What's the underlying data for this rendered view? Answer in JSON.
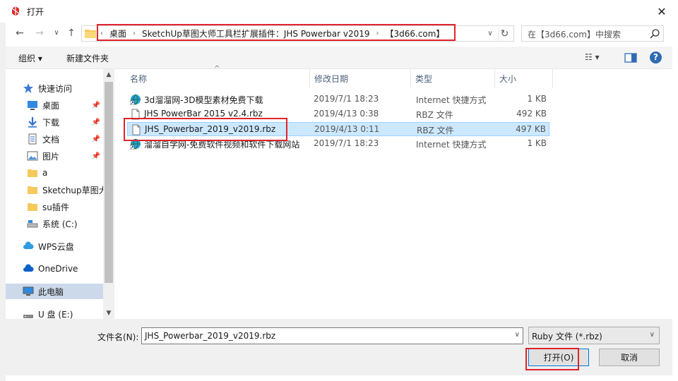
{
  "window": {
    "title": "打开",
    "close_glyph": "✕"
  },
  "nav": {
    "back": "←",
    "forward": "→",
    "dropdown": "∨",
    "up": "↑"
  },
  "address": {
    "crumbs": [
      "桌面",
      "SketchUp草图大师工具栏扩展插件：JHS Powerbar v2019",
      "【3d66.com】"
    ],
    "lead_glyph": "‹",
    "sep_glyph": "›",
    "dropdown_glyph": "∨",
    "refresh_glyph": "↻"
  },
  "search": {
    "placeholder": "在【3d66.com】中搜索"
  },
  "toolbar": {
    "organize_label": "组织 ▾",
    "new_folder_label": "新建文件夹",
    "view_label": "☷ ▾",
    "help_label": "?"
  },
  "sidebar": {
    "items": [
      {
        "label": "快速访问",
        "icon": "star-icon",
        "pinned": false
      },
      {
        "label": "桌面",
        "icon": "desktop-icon",
        "pinned": true
      },
      {
        "label": "下载",
        "icon": "download-icon",
        "pinned": true
      },
      {
        "label": "文档",
        "icon": "document-icon",
        "pinned": true
      },
      {
        "label": "图片",
        "icon": "pictures-icon",
        "pinned": true
      },
      {
        "label": "a",
        "icon": "folder-icon",
        "pinned": false
      },
      {
        "label": "Sketchup草图大",
        "icon": "folder-icon",
        "pinned": false
      },
      {
        "label": "su插件",
        "icon": "folder-icon",
        "pinned": false
      },
      {
        "label": "系统 (C:)",
        "icon": "drive-icon",
        "pinned": false
      },
      {
        "label": "WPS云盘",
        "icon": "cloud-icon",
        "pinned": false
      },
      {
        "label": "OneDrive",
        "icon": "cloud-icon",
        "pinned": false
      },
      {
        "label": "此电脑",
        "icon": "computer-icon",
        "pinned": false
      },
      {
        "label": "U 盘 (E:)",
        "icon": "usb-drive-icon",
        "pinned": false
      }
    ],
    "pin_glyph": "📌",
    "scroll_up": "▲",
    "scroll_down": "▼"
  },
  "columns": {
    "name": "名称",
    "modified": "修改日期",
    "type": "类型",
    "size": "大小",
    "sort_glyph": "^"
  },
  "files": [
    {
      "name": "3d溜溜网-3D模型素材免费下载",
      "date": "2019/7/1 18:23",
      "type": "Internet 快捷方式",
      "size": "1 KB",
      "icon": "internet-shortcut-icon"
    },
    {
      "name": "JHS PowerBar 2015 v2.4.rbz",
      "date": "2019/4/13 0:38",
      "type": "RBZ 文件",
      "size": "492 KB",
      "icon": "file-icon"
    },
    {
      "name": "JHS_Powerbar_2019_v2019.rbz",
      "date": "2019/4/13 0:11",
      "type": "RBZ 文件",
      "size": "497 KB",
      "icon": "file-icon"
    },
    {
      "name": "溜溜自学网-免费软件视频和软件下载网站",
      "date": "2019/7/1 18:23",
      "type": "Internet 快捷方式",
      "size": "1 KB",
      "icon": "internet-shortcut-icon"
    }
  ],
  "bottom": {
    "filename_label": "文件名(N):",
    "filename_value": "JHS_Powerbar_2019_v2019.rbz",
    "filter_value": "Ruby 文件 (*.rbz)",
    "open_label": "打开(O)",
    "cancel_label": "取消"
  },
  "colors": {
    "highlight_red": "#e0232b",
    "selection_blue": "#cce8ff",
    "accent": "#0078d7"
  }
}
